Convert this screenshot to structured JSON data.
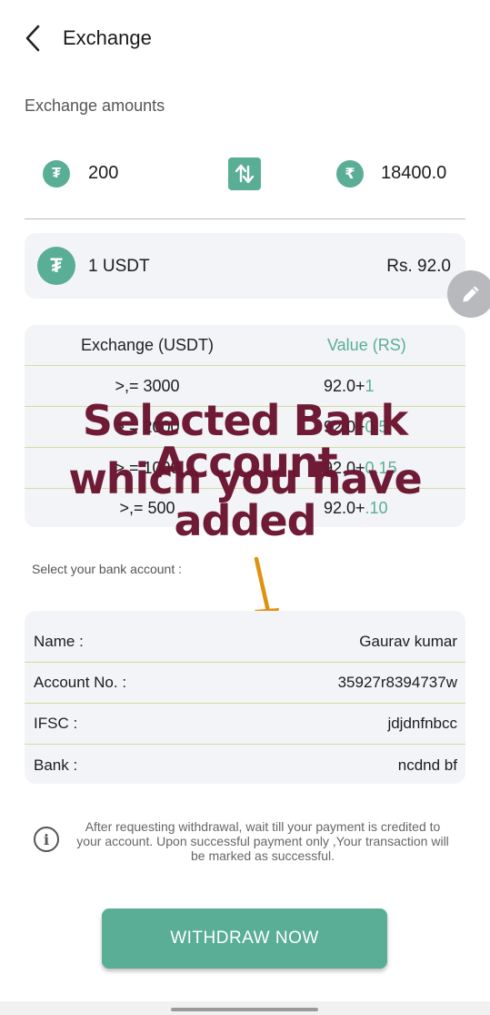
{
  "header": {
    "title": "Exchange"
  },
  "exchange": {
    "section_label": "Exchange amounts",
    "usdt_amount": "200",
    "inr_amount": "18400.0"
  },
  "rate": {
    "left": "1 USDT",
    "right": "Rs. 92.0"
  },
  "table": {
    "col1": "Exchange (USDT)",
    "col2": "Value (RS)",
    "rows": [
      {
        "threshold": ">,= 3000",
        "base": "92.0+",
        "bonus": "1"
      },
      {
        "threshold": ">,= 2000",
        "base": "92.0+",
        "bonus": "0.5"
      },
      {
        "threshold": ">,= 1000",
        "base": "92.0+",
        "bonus": "0.15"
      },
      {
        "threshold": ">,= 500",
        "base": "92.0+",
        "bonus": ".10"
      }
    ]
  },
  "overlay": {
    "line1": "Selected Bank Account",
    "line2": "which you have added"
  },
  "bank": {
    "label": "Select your bank account :",
    "name_label": "Name :",
    "name_value": "Gaurav kumar",
    "account_label": "Account No. :",
    "account_value": "35927r8394737w",
    "ifsc_label": "IFSC :",
    "ifsc_value": "jdjdnfnbcc",
    "bank_label": "Bank :",
    "bank_value": "ncdnd bf"
  },
  "info": {
    "text": "After requesting withdrawal, wait till your payment is credited to your account. Upon successful payment only ,Your transaction will be marked as successful."
  },
  "withdraw": {
    "label": "WITHDRAW NOW"
  },
  "colors": {
    "accent": "#5aae95",
    "overlay_text": "#6b1530",
    "arrow": "#e0920f",
    "card_bg": "#f2f4f7"
  },
  "icons": {
    "back": "chevron-left-icon",
    "usdt": "tether-icon",
    "inr": "rupee-icon",
    "swap": "swap-vertical-icon",
    "edit": "pencil-icon",
    "info": "info-icon"
  }
}
